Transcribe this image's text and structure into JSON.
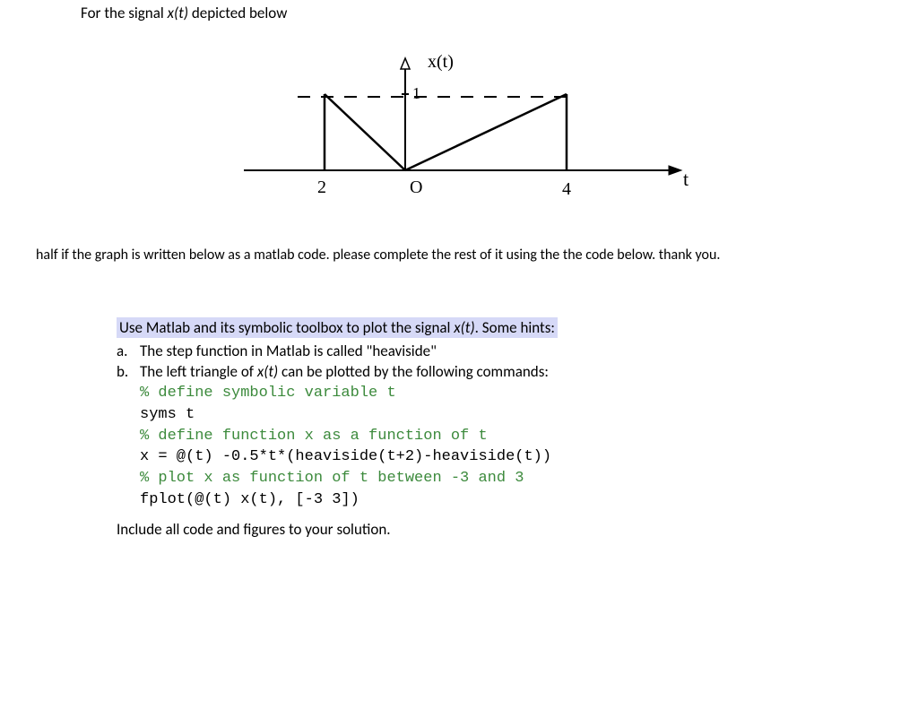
{
  "intro": {
    "prefix": "For the signal ",
    "signal": "x(t)",
    "suffix": " depicted below"
  },
  "graph": {
    "ylabel": "x(t)",
    "ytick": "1",
    "origin": "O",
    "xneg": "2",
    "xpos": "4",
    "xlabel": "t"
  },
  "description": "half if the graph is written below as a matlab code. please complete the rest of it using the the code below. thank you.",
  "question": {
    "highlight_prefix": "Use Matlab and its symbolic toolbox to plot the signal ",
    "highlight_signal": "x(t)",
    "highlight_suffix": ". Some hints:",
    "hints": [
      {
        "label": "a.",
        "text": "The step function in Matlab is called \"heaviside\""
      },
      {
        "label": "b.",
        "text_prefix": "The left triangle of ",
        "text_signal": "x(t)",
        "text_suffix": " can be plotted by the following commands:"
      }
    ],
    "code": [
      {
        "type": "comment",
        "text": "% define symbolic variable t"
      },
      {
        "type": "code",
        "text": "syms t"
      },
      {
        "type": "comment",
        "text": "% define function x as a function of t"
      },
      {
        "type": "code",
        "text": "x = @(t) -0.5*t*(heaviside(t+2)-heaviside(t))"
      },
      {
        "type": "comment",
        "text": "% plot x as function of t between -3 and 3"
      },
      {
        "type": "code",
        "text": "fplot(@(t) x(t), [-3 3])"
      }
    ],
    "closing": "Include all code and figures to your solution."
  },
  "chart_data": {
    "type": "line",
    "title": "x(t)",
    "xlabel": "t",
    "ylabel": "x(t)",
    "x": [
      -2,
      0,
      4,
      4
    ],
    "y": [
      1,
      0,
      1,
      0
    ],
    "annotations": {
      "x_ticks": [
        -2,
        0,
        4
      ],
      "y_ticks": [
        1
      ]
    },
    "xlim": [
      -3,
      8
    ],
    "ylim": [
      0,
      1.2
    ]
  }
}
